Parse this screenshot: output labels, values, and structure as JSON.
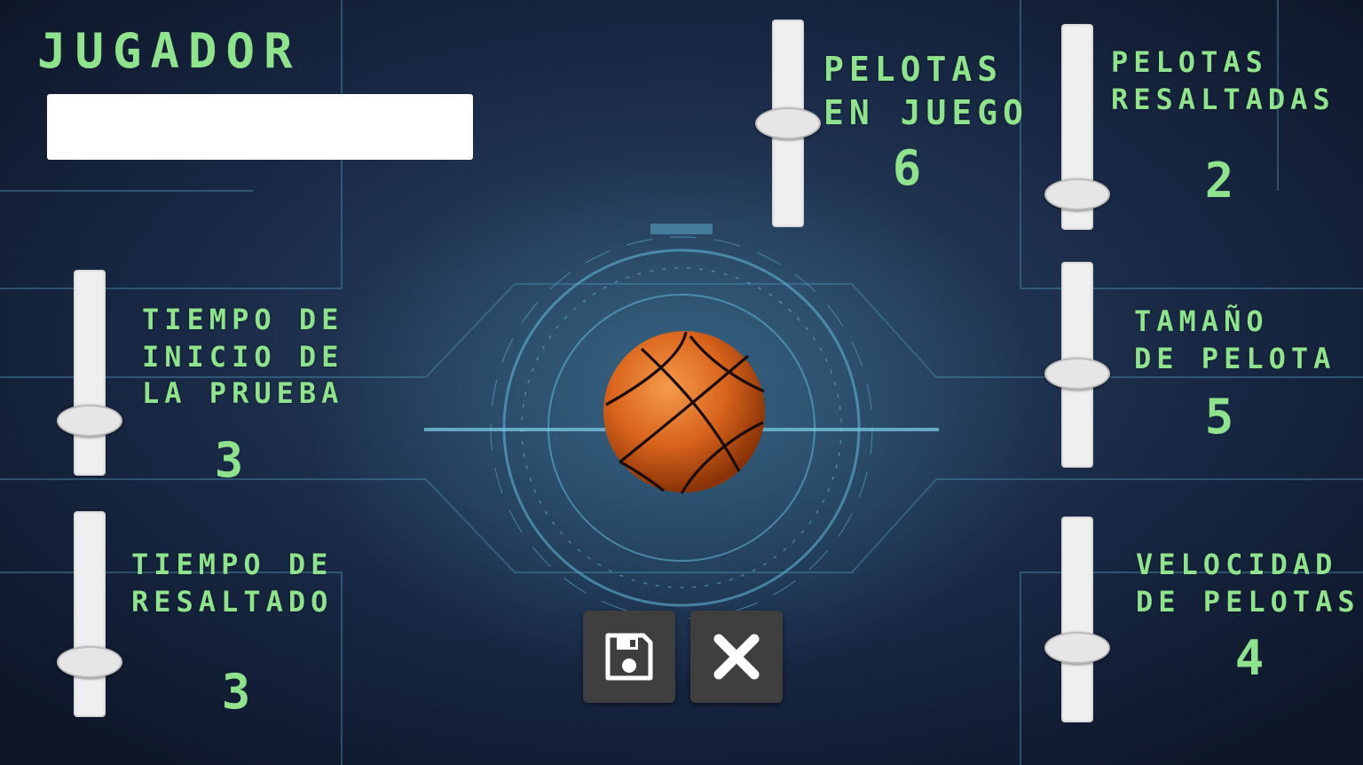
{
  "player": {
    "title": "JUGADOR",
    "name_value": ""
  },
  "settings": {
    "balls_in_play": {
      "label_line1": "PELOTAS",
      "label_line2": "EN JUEGO",
      "value": "6",
      "level": 0.45
    },
    "highlighted_balls": {
      "label_line1": "PELOTAS",
      "label_line2": "RESALTADAS",
      "value": "2",
      "level": 0.15
    },
    "test_start_time": {
      "label_line1": "TIEMPO DE",
      "label_line2": "INICIO DE",
      "label_line3": "LA PRUEBA",
      "value": "3",
      "level": 0.28
    },
    "ball_size": {
      "label_line1": "TAMAÑO",
      "label_line2": "DE PELOTA",
      "value": "5",
      "level": 0.45
    },
    "highlight_time": {
      "label_line1": "TIEMPO DE",
      "label_line2": "RESALTADO",
      "value": "3",
      "level": 0.28
    },
    "ball_speed": {
      "label_line1": "VELOCIDAD",
      "label_line2": "DE PELOTAS",
      "value": "4",
      "level": 0.38
    }
  },
  "buttons": {
    "save_icon": "floppy-disk-icon",
    "close_icon": "close-icon"
  },
  "colors": {
    "accent": "#8fe38c",
    "background": "#16213a",
    "button": "#3f3f3f",
    "track": "#efefef"
  }
}
